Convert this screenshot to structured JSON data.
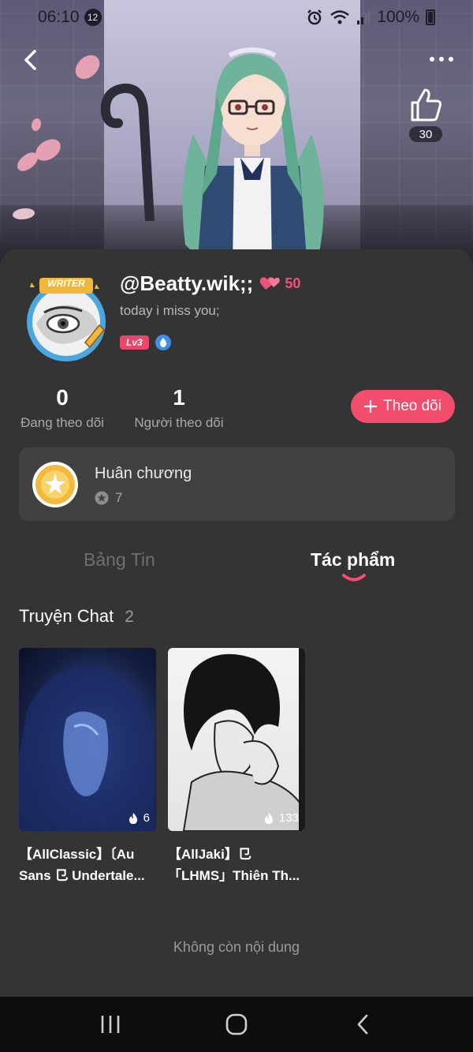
{
  "status_bar": {
    "time": "06:10",
    "notification_count": "12",
    "battery": "100%"
  },
  "header": {
    "like_count": "30"
  },
  "profile": {
    "username": "@Beatty.wik;;",
    "heart_count": "50",
    "bio": "today i miss you;",
    "level": "Lv3",
    "avatar_badge": "WRITER"
  },
  "stats": {
    "following_count": "0",
    "following_label": "Đang theo dõi",
    "followers_count": "1",
    "followers_label": "Người theo dõi"
  },
  "follow_button": {
    "label": "Theo dõi"
  },
  "medals": {
    "title": "Huân chương",
    "count": "7"
  },
  "tabs": [
    {
      "label": "Bảng Tin",
      "active": false
    },
    {
      "label": "Tác phẩm",
      "active": true
    }
  ],
  "section": {
    "title": "Truyện Chat",
    "count": "2"
  },
  "stories": [
    {
      "title": "【AllClassic】〔Au Sans ⺋ Undertale...",
      "views": "6"
    },
    {
      "title": "【AllJaki】⺋「LHMS」Thiên Th...",
      "views": "133"
    }
  ],
  "footer": {
    "end_text": "Không còn nội dung"
  },
  "colors": {
    "accent": "#f24d6c",
    "background": "#343434",
    "card": "#414141"
  }
}
